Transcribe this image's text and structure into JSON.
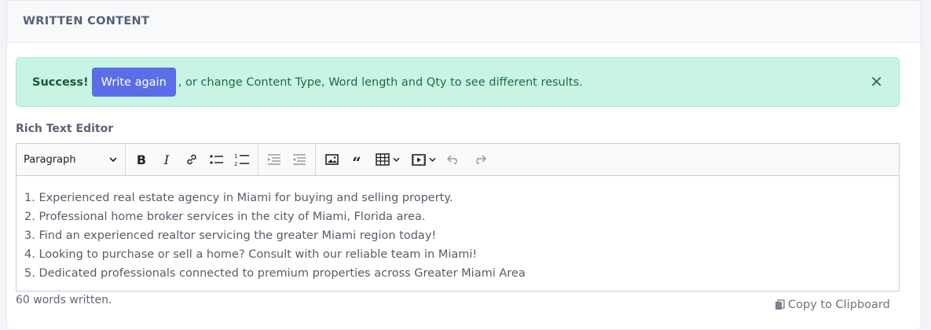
{
  "header": {
    "title": "WRITTEN CONTENT"
  },
  "alert": {
    "strong": "Success!",
    "button_label": "Write again",
    "message": ", or change Content Type, Word length and Qty to see different results.",
    "close_glyph": "✕"
  },
  "editor": {
    "label": "Rich Text Editor",
    "paragraph_select": "Paragraph",
    "toolbar_icons": [
      "bold-icon",
      "italic-icon",
      "link-icon",
      "bulleted-list-icon",
      "numbered-list-icon",
      "indent-icon",
      "outdent-icon",
      "image-icon",
      "blockquote-icon",
      "table-icon",
      "media-icon",
      "undo-icon",
      "redo-icon"
    ],
    "lines": [
      "1. Experienced real estate agency in Miami for buying and selling property.",
      "2. Professional home broker services in the city of Miami, Florida area.",
      "3. Find an experienced realtor servicing the greater Miami region today!",
      "4. Looking to purchase or sell a home? Consult with our reliable team in Miami!",
      "5. Dedicated professionals connected to premium properties across Greater Miami Area"
    ]
  },
  "footer": {
    "word_count": "60 words written.",
    "copy_label": "Copy to Clipboard"
  },
  "colors": {
    "alert_bg": "#c9f4e3",
    "button_bg": "#5b6ee8"
  }
}
